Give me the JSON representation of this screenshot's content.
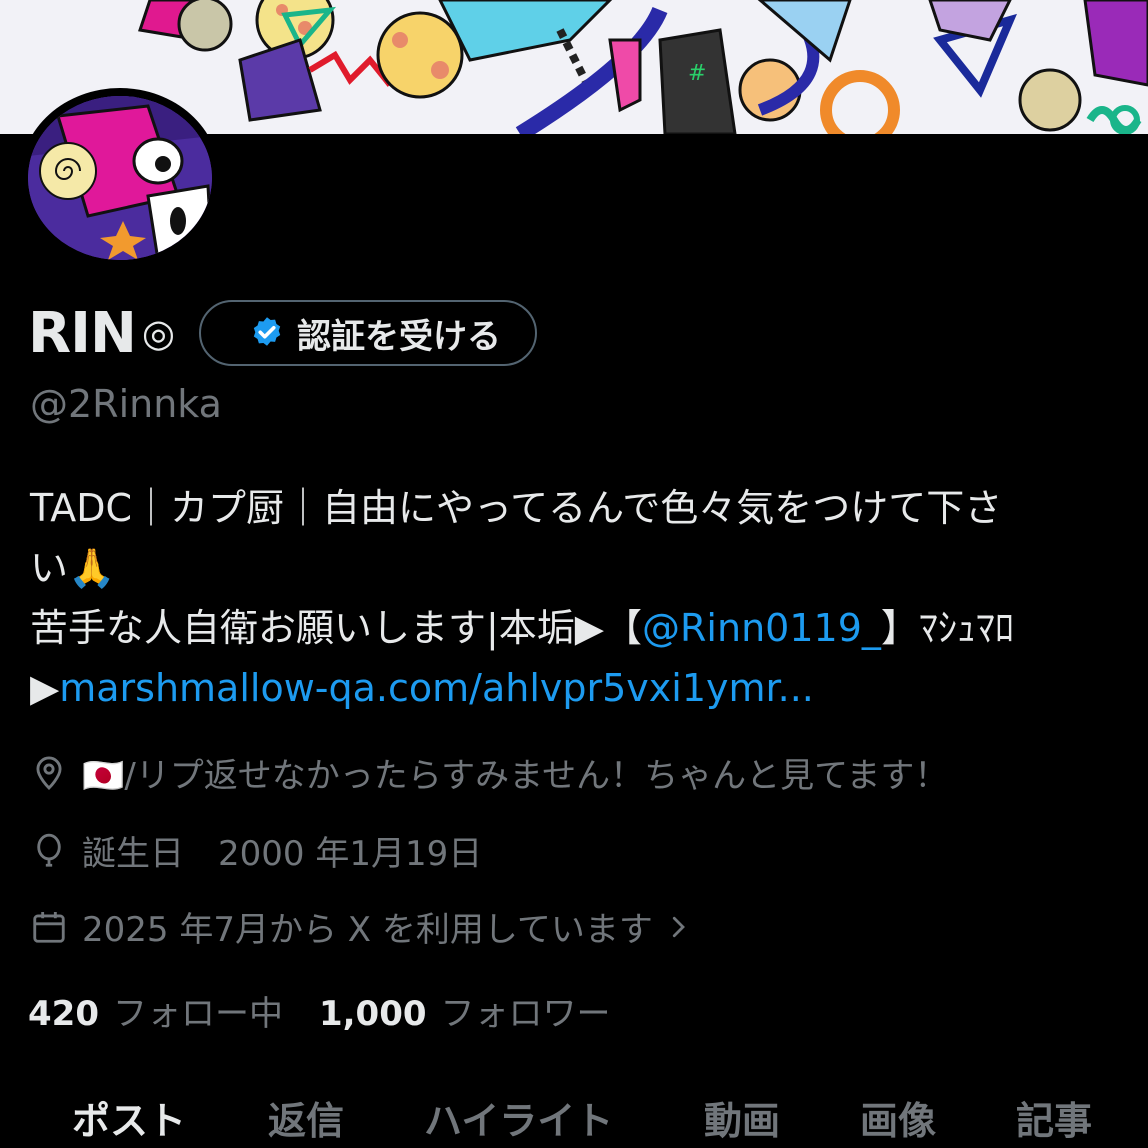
{
  "profile": {
    "name": "RIN",
    "name_suffix": "◎",
    "verify_label": "認証を受ける",
    "handle": "@2Rinnka"
  },
  "bio": {
    "line1": "TADC｜カプ厨｜自由にやってるんで色々気をつけて下さ",
    "line2": "い🙏",
    "line3_prefix": "苦手な人自衛お願いします|本垢▶【",
    "mention": "@Rinn0119_",
    "line3_suffix": "】ﾏｼｭﾏﾛ",
    "line4_prefix": "▶",
    "link": "marshmallow-qa.com/ahlvpr5vxi1ymr..."
  },
  "meta": {
    "location": "🇯🇵/リプ返せなかったらすみません！ちゃんと見てます！",
    "birthday": "誕生日　2000 年1月19日",
    "joined": "2025 年7月から X を利用しています"
  },
  "counts": {
    "following_num": "420",
    "following_label": "フォロー中",
    "followers_num": "1,000",
    "followers_label": "フォロワー"
  },
  "tabs": [
    "ポスト",
    "返信",
    "ハイライト",
    "動画",
    "画像",
    "記事"
  ],
  "colors": {
    "background": "#000000",
    "text": "#e7e9ea",
    "muted": "#71767b",
    "link": "#1d9bf0",
    "verified": "#1d9bf0"
  }
}
